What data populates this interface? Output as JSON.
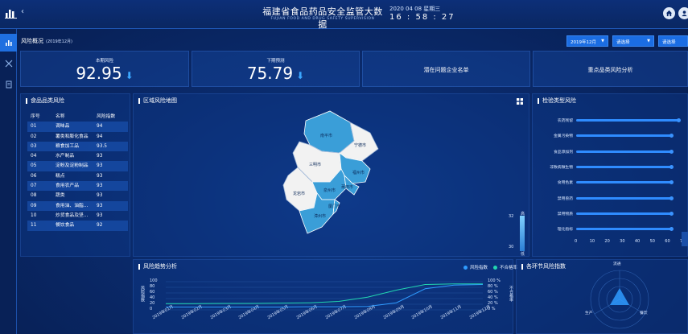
{
  "header": {
    "title": "福建省食品药品安全监管大数据",
    "subtitle": "FUJIAN FOOD AND DRUG SAFETY SUPERVISION",
    "date": "2020 04 08 星期三",
    "time": "16 : 58 : 27",
    "back_glyph": "‹"
  },
  "overview": {
    "title": "风险概况",
    "period": "(2019年12月)",
    "filters": [
      "2019年12月",
      "请选择",
      "请选择"
    ]
  },
  "stats": [
    {
      "label": "本期风险",
      "value": "92.95",
      "trend": "down"
    },
    {
      "label": "下期预测",
      "value": "75.79",
      "trend": "down"
    },
    {
      "label": "潜在问题企业名单"
    },
    {
      "label": "重点品类风险分析"
    }
  ],
  "food_panel": {
    "title": "食品品类风险",
    "headers": [
      "序号",
      "名称",
      "风险指数"
    ],
    "rows": [
      [
        "01",
        "调味品",
        "94"
      ],
      [
        "02",
        "薯类和膨化食品",
        "94"
      ],
      [
        "03",
        "粮食加工品",
        "93.5"
      ],
      [
        "04",
        "水产制品",
        "93"
      ],
      [
        "05",
        "淀粉及淀粉制品",
        "93"
      ],
      [
        "06",
        "糕点",
        "93"
      ],
      [
        "07",
        "食用农产品",
        "93"
      ],
      [
        "08",
        "蔬类",
        "93"
      ],
      [
        "09",
        "食用油、油脂…",
        "93"
      ],
      [
        "10",
        "炒货食品及坚…",
        "93"
      ],
      [
        "11",
        "餐饮食品",
        "92"
      ]
    ]
  },
  "map_panel": {
    "title": "区域风险地图",
    "regions": [
      "南平市",
      "宁德市",
      "三明市",
      "福州市",
      "龙岩市",
      "泉州市",
      "莆田市",
      "漳州市",
      "厦门市"
    ],
    "legend_high": "32",
    "legend_low": "30",
    "legend_high_label": "高",
    "legend_low_label": "低"
  },
  "inspection_panel": {
    "title": "检验类型风险",
    "ticks": [
      "0",
      "10",
      "20",
      "30",
      "40",
      "50",
      "60",
      "70"
    ],
    "bars": [
      {
        "label": "农药残留",
        "value": 68
      },
      {
        "label": "金属污染物",
        "value": 63
      },
      {
        "label": "食品添加剂",
        "value": 63
      },
      {
        "label": "非致病微生物",
        "value": 63
      },
      {
        "label": "食用色素",
        "value": 63
      },
      {
        "label": "禁用兽药",
        "value": 63
      },
      {
        "label": "禁用物质",
        "value": 63
      },
      {
        "label": "理化指标",
        "value": 63
      }
    ]
  },
  "trend_panel": {
    "title": "风险趋势分析",
    "legend": [
      {
        "name": "风险指数",
        "color": "#2f9bff"
      },
      {
        "name": "不合格率",
        "color": "#22d6b0"
      }
    ],
    "left_ticks": [
      "100",
      "80",
      "60",
      "40",
      "20",
      "0"
    ],
    "right_ticks": [
      "100 %",
      "80 %",
      "60 %",
      "40 %",
      "20 %",
      "0 %"
    ],
    "left_axis_label": "风险指数",
    "right_axis_label": "不合格率"
  },
  "chart_data": {
    "type": "line",
    "x": [
      "2019年01月",
      "2019年02月",
      "2019年03月",
      "2019年04月",
      "2019年05月",
      "2019年06月",
      "2019年07月",
      "2019年08月",
      "2019年09月",
      "2019年10月",
      "2019年11月",
      "2019年12月"
    ],
    "series": [
      {
        "name": "风险指数",
        "values": [
          10,
          10,
          10,
          10,
          10,
          11,
          11,
          12,
          25,
          75,
          88,
          90
        ]
      },
      {
        "name": "不合格率",
        "values": [
          22,
          22,
          23,
          23,
          24,
          25,
          30,
          45,
          70,
          90,
          92,
          92
        ]
      }
    ],
    "ylim": [
      0,
      100
    ],
    "y2lim": [
      0,
      100
    ]
  },
  "radar_panel": {
    "title": "各环节风险指数",
    "labels": [
      "流通",
      "生产",
      "餐饮"
    ]
  },
  "icons": {
    "logo": "bar-chart-logo-icon",
    "home": "home-icon",
    "user": "user-icon",
    "rail": [
      "chart-icon",
      "tools-icon",
      "document-icon"
    ],
    "grid": "grid-view-icon"
  },
  "colors": {
    "accent": "#1b6de3",
    "bar": "#2f8cff",
    "map_dark": "#3a9ed8",
    "map_light": "#f2f2f2"
  }
}
